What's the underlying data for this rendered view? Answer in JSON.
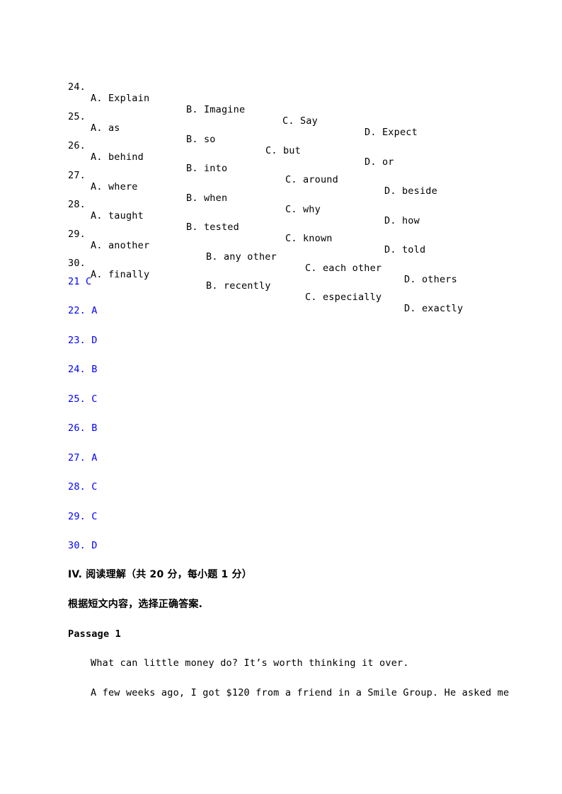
{
  "questions": [
    {
      "num": "24.",
      "options": [
        "A. Explain",
        "B. Imagine",
        "C. Say",
        "D. Expect"
      ]
    },
    {
      "num": "25.",
      "options": [
        "A. as",
        "B. so",
        "C. but",
        "D. or"
      ]
    },
    {
      "num": "26.",
      "options": [
        "A. behind",
        "B. into",
        "C. around",
        "D. beside"
      ]
    },
    {
      "num": "27.",
      "options": [
        "A. where",
        "B. when",
        "C. why",
        "D. how"
      ]
    },
    {
      "num": "28.",
      "options": [
        "A. taught",
        "B. tested",
        "C. known",
        "D. told"
      ]
    },
    {
      "num": "29.",
      "options": [
        "A. another",
        "B. any other",
        "C. each other",
        "D. others"
      ]
    },
    {
      "num": "30.",
      "options": [
        "A. finally",
        "B. recently",
        "C. especially",
        "D. exactly"
      ]
    }
  ],
  "answers": [
    "21 C",
    "22. A",
    "23. D",
    "24. B",
    "25. C",
    "26. B",
    "27. A",
    "28. C",
    "29. C",
    "30. D"
  ],
  "section": {
    "heading": "IV. 阅读理解（共 20 分，每小题 1 分）",
    "instruction": "根据短文内容，选择正确答案.",
    "passage_title": "Passage 1",
    "paragraphs": [
      "What can little money do? It’s worth thinking it over.",
      "A few weeks ago, I got $120 from a friend in a Smile Group. He asked me"
    ]
  },
  "colors": {
    "answer_text": "#0000ff",
    "body_text": "#000000"
  }
}
